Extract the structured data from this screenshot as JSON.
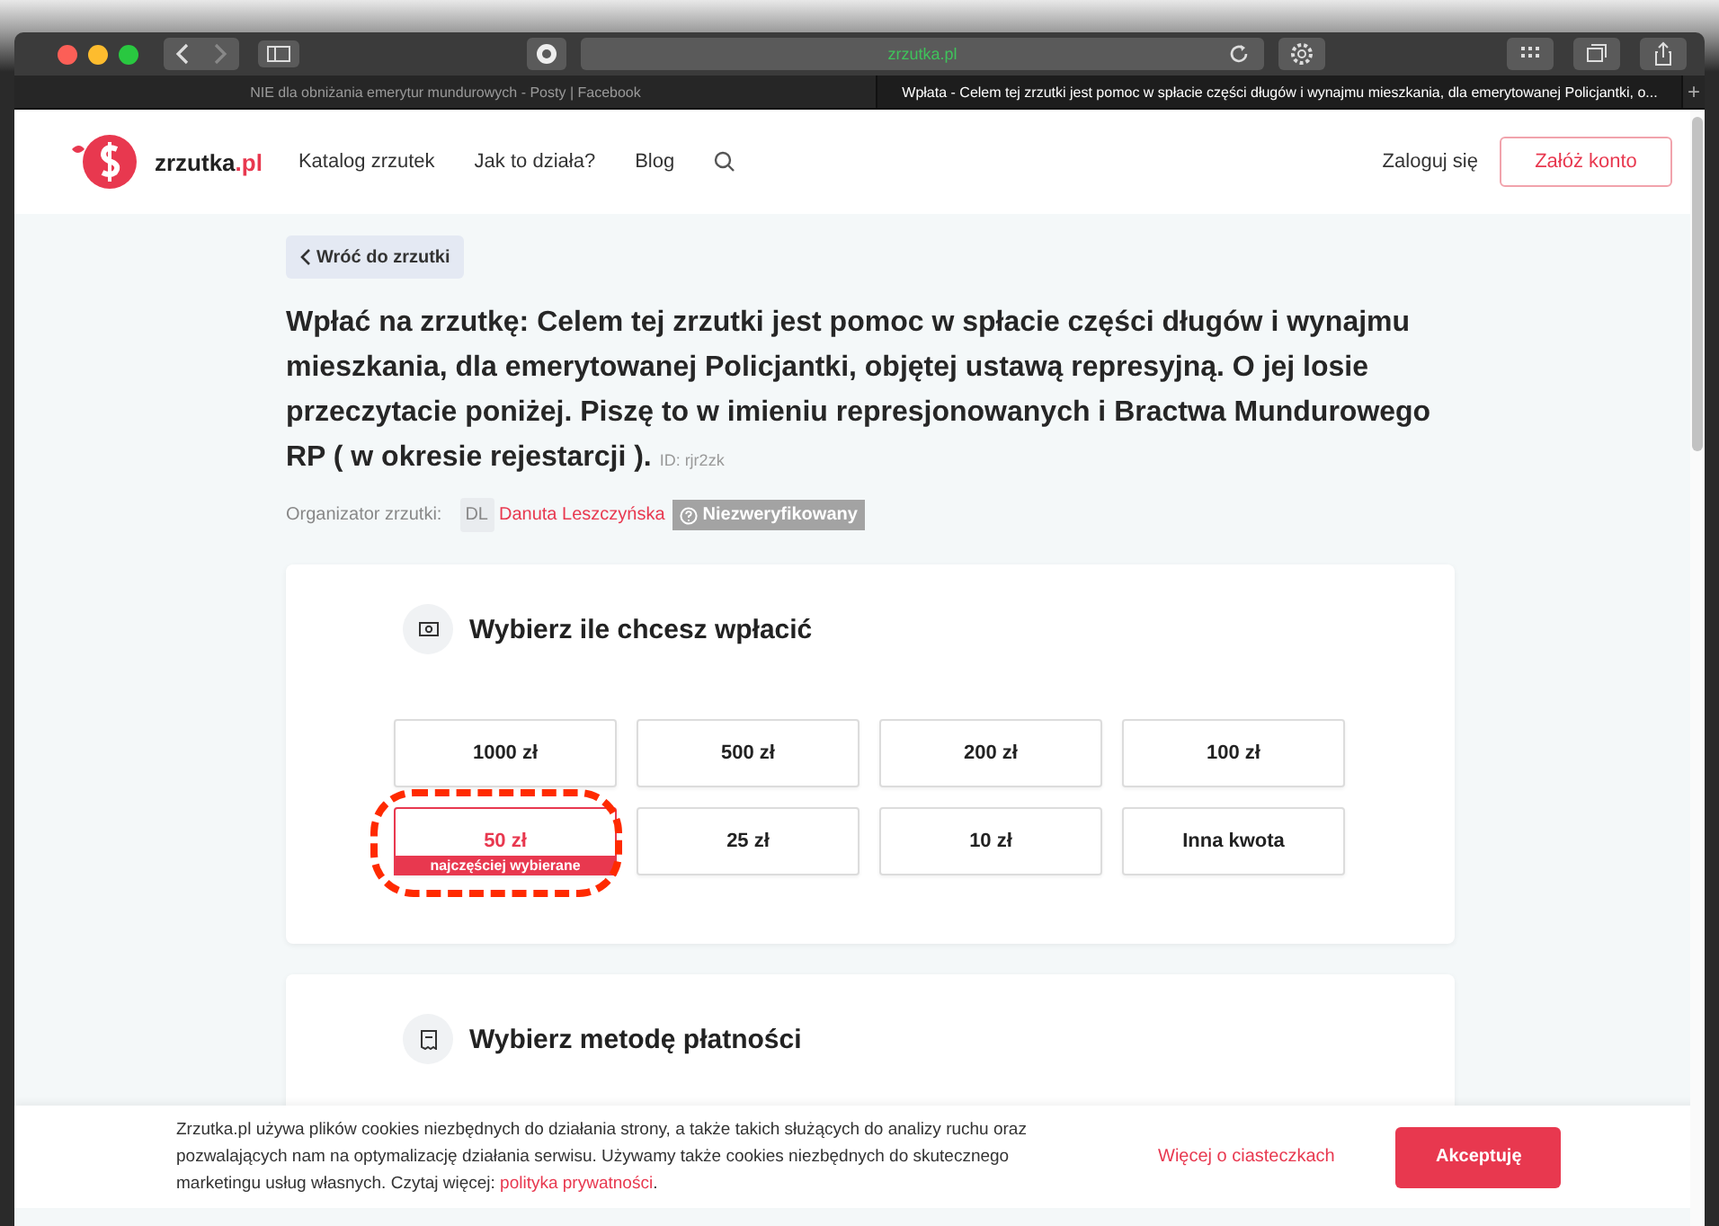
{
  "browser": {
    "url": "zrzutka.pl",
    "tabs": [
      {
        "title": "NIE dla obniżania emerytur mundurowych - Posty | Facebook",
        "selected": false
      },
      {
        "title": "Wpłata - Celem tej zrzutki jest pomoc w spłacie części długów i wynajmu mieszkania, dla emerytowanej Policjantki, o...",
        "selected": true
      }
    ],
    "new_tab": "+"
  },
  "nav": {
    "logo_name": "zrzutka",
    "logo_tld": ".pl",
    "links": [
      "Katalog zrzutek",
      "Jak to działa?",
      "Blog"
    ],
    "login": "Zaloguj się",
    "register": "Załóż konto"
  },
  "back_link": "Wróć do zrzutki",
  "title": "Wpłać na zrzutkę: Celem tej zrzutki jest pomoc w spłacie części długów i wynajmu mieszkania, dla emerytowanej Policjantki, objętej ustawą represyjną. O jej losie przeczytacie poniżej. Piszę to w imieniu represjonowanych i Bractwa Mundurowego RP ( w okresie rejestarcji ).",
  "id_label": "ID: rjr2zk",
  "organizer": {
    "label": "Organizator zrzutki:",
    "initials": "DL",
    "name": "Danuta Leszczyńska",
    "badge": "Niezweryfikowany"
  },
  "amount_section": {
    "title": "Wybierz ile chcesz wpłacić",
    "options": [
      {
        "label": "1000 zł",
        "selected": false
      },
      {
        "label": "500 zł",
        "selected": false
      },
      {
        "label": "200 zł",
        "selected": false
      },
      {
        "label": "100 zł",
        "selected": false
      },
      {
        "label": "50 zł",
        "selected": true,
        "badge": "najczęściej wybierane"
      },
      {
        "label": "25 zł",
        "selected": false
      },
      {
        "label": "10 zł",
        "selected": false
      },
      {
        "label": "Inna kwota",
        "selected": false
      }
    ]
  },
  "payment_section": {
    "title": "Wybierz metodę płatności"
  },
  "cookie": {
    "text": "Zrzutka.pl używa plików cookies niezbędnych do działania strony, a także takich służących do analizy ruchu oraz pozwalających nam na optymalizację działania serwisu. Używamy także cookies niezbędnych do skutecznego marketingu usług własnych. Czytaj więcej: ",
    "link": "polityka prywatności",
    "text_end": ".",
    "more": "Więcej o ciasteczkach",
    "accept": "Akceptuję"
  }
}
